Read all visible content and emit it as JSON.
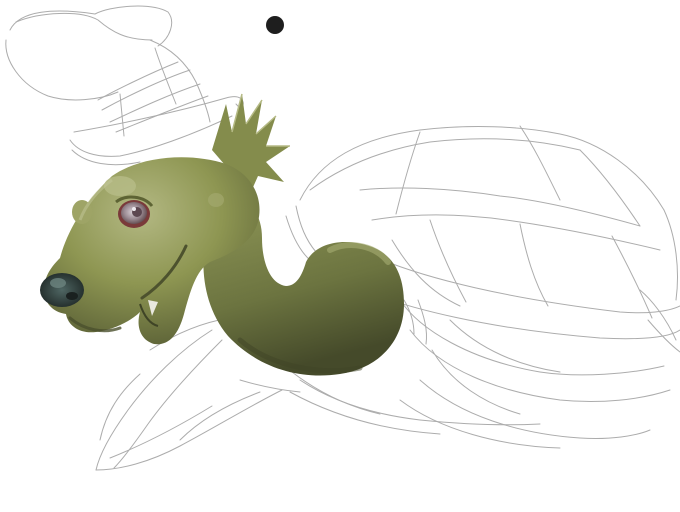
{
  "canvas": {
    "background": "#ffffff",
    "sketch_color": "#a8a8a8",
    "paint_colors": {
      "base": "#7d8544",
      "highlight": "#b3b883",
      "shadow": "#4e532f",
      "nose": "#2a3533",
      "eye_iris": "#9a8a92",
      "eye_rim": "#7a3a3a"
    }
  },
  "brush_cursor": {
    "icon": "brush-dot-icon",
    "color": "#1e1e1e"
  }
}
